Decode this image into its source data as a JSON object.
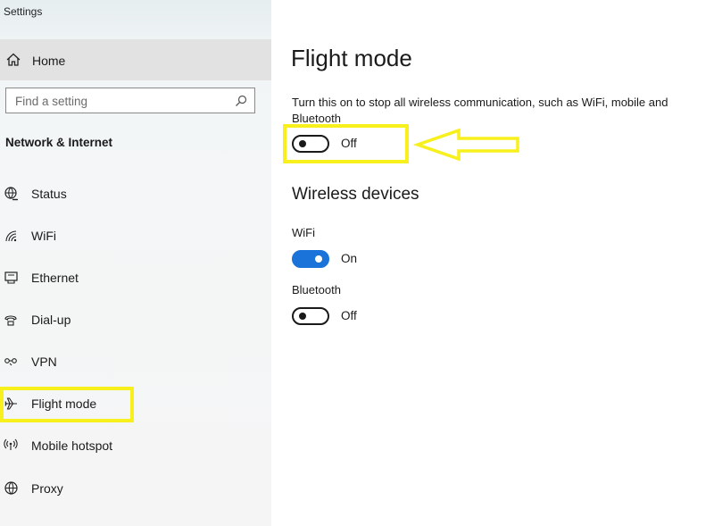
{
  "window": {
    "title": "Settings"
  },
  "sidebar": {
    "home_label": "Home",
    "search_placeholder": "Find a setting",
    "section_title": "Network & Internet",
    "items": [
      {
        "label": "Status",
        "icon": "globe-status-icon"
      },
      {
        "label": "WiFi",
        "icon": "wifi-icon"
      },
      {
        "label": "Ethernet",
        "icon": "ethernet-icon"
      },
      {
        "label": "Dial-up",
        "icon": "dial-up-icon"
      },
      {
        "label": "VPN",
        "icon": "vpn-icon"
      },
      {
        "label": "Flight mode",
        "icon": "airplane-icon",
        "selected": true
      },
      {
        "label": "Mobile hotspot",
        "icon": "hotspot-icon"
      },
      {
        "label": "Proxy",
        "icon": "globe-icon"
      }
    ]
  },
  "main": {
    "title": "Flight mode",
    "description": "Turn this on to stop all wireless communication, such as WiFi, mobile and Bluetooth",
    "flight_mode_toggle": {
      "state": "Off",
      "on": false
    },
    "wireless_heading": "Wireless devices",
    "wifi": {
      "label": "WiFi",
      "state": "On",
      "on": true
    },
    "bluetooth": {
      "label": "Bluetooth",
      "state": "Off",
      "on": false
    }
  },
  "annotations": {
    "highlight_color": "#f7f01c"
  },
  "colors": {
    "toggle_on": "#1a73d9",
    "toggle_off_border": "#1a1a1a"
  }
}
